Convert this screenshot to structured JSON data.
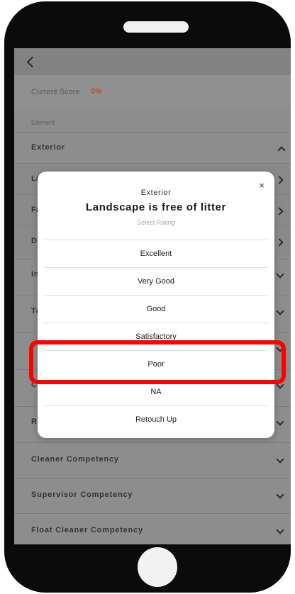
{
  "header": {
    "back_icon": "chevron-left-icon"
  },
  "score": {
    "label": "Current Score",
    "value": "0%"
  },
  "element_label": "Element",
  "sections": {
    "exterior": "Exterior",
    "cleaner": "Cleaner Competency",
    "supervisor": "Supervisor Competency",
    "float_cleaner": "Float Cleaner Competency"
  },
  "background_rows": [
    "La",
    "Fa",
    "D",
    "In",
    "Te",
    "",
    "C",
    "R"
  ],
  "modal": {
    "category": "Exterior",
    "title": "Landscape is free of litter",
    "subtitle": "Select Rating",
    "close": "×",
    "options": [
      "Excellent",
      "Very Good",
      "Good",
      "Satisfactory",
      "Poor",
      "NA",
      "Retouch Up"
    ]
  },
  "colors": {
    "highlight": "#ff0000",
    "score_accent": "#b8541c"
  }
}
